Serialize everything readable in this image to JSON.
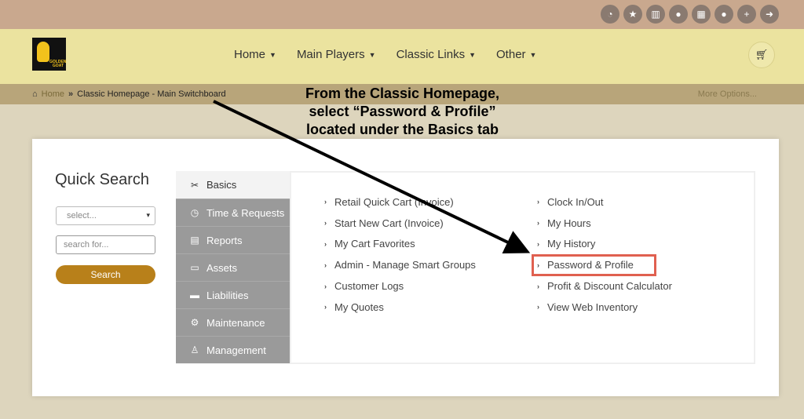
{
  "topbar": {
    "icons": [
      "dashboard-icon",
      "star-icon",
      "building-icon",
      "users-icon",
      "calendar-icon",
      "user-icon",
      "user-plus-icon",
      "sign-out-icon"
    ]
  },
  "logo": {
    "text_line1": "GOLDEN",
    "text_line2": "GOAT"
  },
  "nav": {
    "items": [
      "Home",
      "Main Players",
      "Classic Links",
      "Other"
    ]
  },
  "breadcrumb": {
    "home": "Home",
    "current": "Classic Homepage - Main Switchboard",
    "more_options": "More Options..."
  },
  "annotation": {
    "line1": "From the Classic Homepage,",
    "line2": "select “Password & Profile”",
    "line3": "located under the Basics tab"
  },
  "quick_search": {
    "title": "Quick Search",
    "select_value": "select...",
    "input_placeholder": "search for...",
    "button_label": "Search"
  },
  "tabs": [
    {
      "label": "Basics",
      "icon": "tools-icon"
    },
    {
      "label": "Time & Requests",
      "icon": "clock-icon"
    },
    {
      "label": "Reports",
      "icon": "report-icon"
    },
    {
      "label": "Assets",
      "icon": "money-icon"
    },
    {
      "label": "Liabilities",
      "icon": "credit-card-icon"
    },
    {
      "label": "Maintenance",
      "icon": "gear-icon"
    },
    {
      "label": "Management",
      "icon": "user-tie-icon"
    }
  ],
  "links_left": [
    "Retail Quick Cart (Invoice)",
    "Start New Cart (Invoice)",
    "My Cart Favorites",
    "Admin - Manage Smart Groups",
    "Customer Logs",
    "My Quotes"
  ],
  "links_right": [
    "Clock In/Out",
    "My Hours",
    "My History",
    "Password & Profile",
    "Profit & Discount Calculator",
    "View Web Inventory"
  ],
  "colors": {
    "topbar": "#c9a88e",
    "navbar": "#ebe39f",
    "breadcrumb_bar": "#b8a57a",
    "search_button": "#b8801a",
    "highlight": "#e06050"
  }
}
